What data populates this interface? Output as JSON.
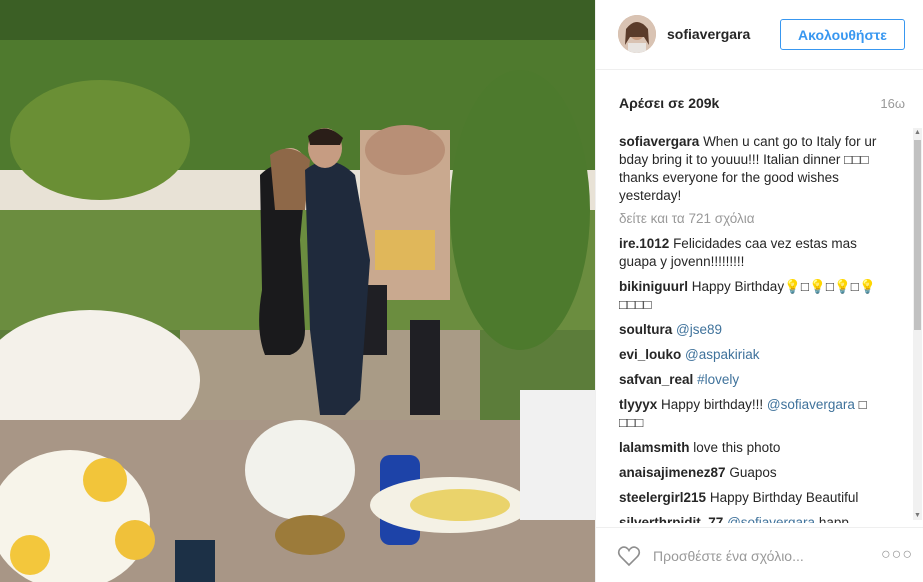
{
  "post": {
    "username": "sofiavergara",
    "follow_label": "Ακολουθήστε",
    "likes_text": "Αρέσει σε 209k",
    "time_ago": "16ω"
  },
  "caption": {
    "username": "sofiavergara",
    "text": "When u cant go to Italy for ur bday bring it to youuu!!! Italian dinner □□□ thanks everyone for the good wishes yesterday!"
  },
  "view_all_comments": "δείτε και τα 721 σχόλια",
  "comments": [
    {
      "user": "ire.1012",
      "text": "Felicidades caa vez estas mas guapa y jovenn!!!!!!!!!"
    },
    {
      "user": "bikiniguurl",
      "text": "Happy Birthday💡□💡□💡□💡 □□□□"
    },
    {
      "user": "soultura",
      "mention": "@jse89"
    },
    {
      "user": "evi_louko",
      "mention": "@aspakiriak"
    },
    {
      "user": "safvan_real",
      "mention": "#lovely"
    },
    {
      "user": "tlyyyx",
      "text": "Happy birthday!!! ",
      "mention": "@sofiavergara",
      "after": " □ □□□"
    },
    {
      "user": "lalamsmith",
      "text": "love this photo"
    },
    {
      "user": "anaisajimenez87",
      "text": "Guapos"
    },
    {
      "user": "steelergirl215",
      "text": "Happy Birthday Beautiful"
    },
    {
      "user": "silverthrpidit_77",
      "mention": "@sofiavergara",
      "after": " happ"
    }
  ],
  "footer": {
    "add_comment_placeholder": "Προσθέστε ένα σχόλιο...",
    "more_label": "○○○"
  },
  "icons": {
    "heart": "heart-icon",
    "more": "more-options-icon",
    "scroll_up": "scroll-up-arrow",
    "scroll_down": "scroll-down-arrow"
  },
  "colors": {
    "accent": "#3897f0",
    "link": "#3f729b",
    "muted": "#999999",
    "text": "#262626"
  }
}
